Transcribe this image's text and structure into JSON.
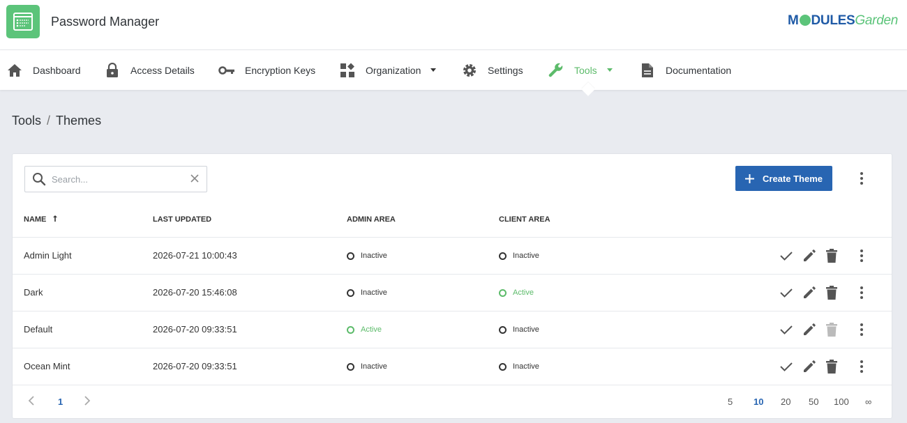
{
  "app": {
    "title": "Password Manager",
    "brand_strong": "M",
    "brand_mid": "DULES",
    "brand_light": "Garden"
  },
  "nav": [
    {
      "label": "Dashboard",
      "icon": "home-icon"
    },
    {
      "label": "Access Details",
      "icon": "lock-icon"
    },
    {
      "label": "Encryption Keys",
      "icon": "key-icon"
    },
    {
      "label": "Organization",
      "icon": "widgets-icon",
      "dropdown": true
    },
    {
      "label": "Settings",
      "icon": "gear-icon"
    },
    {
      "label": "Tools",
      "icon": "wrench-icon",
      "dropdown": true,
      "active": true
    },
    {
      "label": "Documentation",
      "icon": "document-icon"
    }
  ],
  "breadcrumb": {
    "parent": "Tools",
    "separator": "/",
    "current": "Themes"
  },
  "search": {
    "placeholder": "Search...",
    "value": ""
  },
  "create_button": {
    "label": "Create Theme"
  },
  "table": {
    "columns": [
      "NAME",
      "LAST UPDATED",
      "ADMIN AREA",
      "CLIENT AREA"
    ],
    "sort_column": "NAME",
    "rows": [
      {
        "name": "Admin Light",
        "updated": "2026-07-21 10:00:43",
        "admin": "Inactive",
        "client": "Inactive",
        "delete_enabled": true
      },
      {
        "name": "Dark",
        "updated": "2026-07-20 15:46:08",
        "admin": "Inactive",
        "client": "Active",
        "delete_enabled": true
      },
      {
        "name": "Default",
        "updated": "2026-07-20 09:33:51",
        "admin": "Active",
        "client": "Inactive",
        "delete_enabled": false
      },
      {
        "name": "Ocean Mint",
        "updated": "2026-07-20 09:33:51",
        "admin": "Inactive",
        "client": "Inactive",
        "delete_enabled": true
      }
    ]
  },
  "pagination": {
    "current_page": "1",
    "page_sizes": [
      "5",
      "10",
      "20",
      "50",
      "100",
      "∞"
    ],
    "selected_size": "10"
  },
  "colors": {
    "accent_green": "#5cbb6a",
    "primary_blue": "#2865b2",
    "background": "#e9ebf0"
  }
}
